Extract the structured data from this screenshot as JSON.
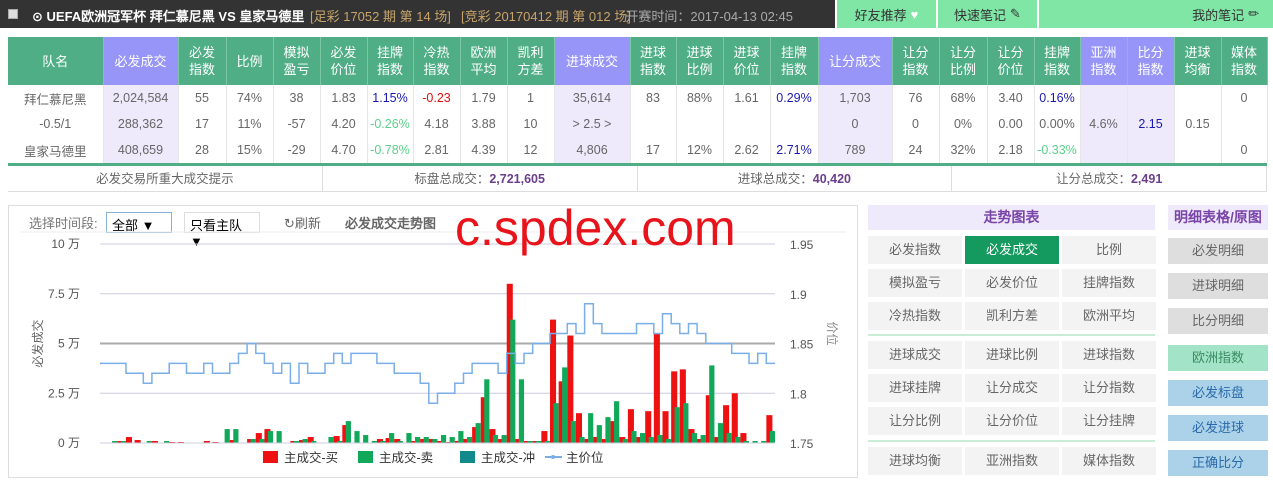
{
  "header": {
    "title": "⊙ UEFA欧洲冠军杯  拜仁慕尼黑  VS 皇家马德里",
    "zucai": "[足彩 17052 期 第 14 场]",
    "jingcai": "[竞彩 20170412 期 第 012 场]",
    "kickoff": "开赛时间：2017-04-13 02:45",
    "buttons": [
      "好友推荐",
      "快速笔记",
      "我的笔记"
    ]
  },
  "table": {
    "headers": [
      "队名",
      "必发成交",
      "必发\n指数",
      "比例",
      "模拟\n盈亏",
      "必发\n价位",
      "挂牌\n指数",
      "冷热\n指数",
      "欧洲\n平均",
      "凯利\n方差",
      "进球成交",
      "进球\n指数",
      "进球\n比例",
      "进球\n价位",
      "挂牌\n指数",
      "让分成交",
      "让分\n指数",
      "让分\n比例",
      "让分\n价位",
      "挂牌\n指数",
      "亚洲\n指数",
      "比分\n指数",
      "进球\n均衡",
      "媒体\n指数"
    ],
    "rows": [
      [
        "拜仁慕尼黑",
        "2,024,584",
        "55",
        "74%",
        "38",
        "1.83",
        "1.15%",
        "-0.23",
        "1.79",
        "1",
        "35,614",
        "83",
        "88%",
        "1.61",
        "0.29%",
        "1,703",
        "76",
        "68%",
        "3.40",
        "0.16%",
        "",
        "",
        "",
        "0"
      ],
      [
        "-0.5/1",
        "288,362",
        "17",
        "11%",
        "-57",
        "4.20",
        "-0.26%",
        "4.18",
        "3.88",
        "10",
        "> 2.5 >",
        "",
        "",
        "",
        "",
        "0",
        "0",
        "0%",
        "0.00",
        "0.00%",
        "4.6%",
        "2.15",
        "0.15",
        ""
      ],
      [
        "皇家马德里",
        "408,659",
        "28",
        "15%",
        "-29",
        "4.70",
        "-0.78%",
        "2.81",
        "4.39",
        "12",
        "4,806",
        "17",
        "12%",
        "2.62",
        "2.71%",
        "789",
        "24",
        "32%",
        "2.18",
        "-0.33%",
        "",
        "",
        "",
        "0"
      ]
    ]
  },
  "summary": {
    "tip": "必发交易所重大成交提示",
    "biaopan_label": "标盘总成交：",
    "biaopan": "2,721,605",
    "jinqiu_label": "进球总成交：",
    "jinqiu": "40,420",
    "rangfen_label": "让分总成交：",
    "rangfen": "2,491"
  },
  "controls": {
    "period_label": "选择时间段:",
    "period_value": "全部 ▼",
    "team_value": "只看主队 ▼",
    "refresh": "刷新",
    "chart_title": "必发成交走势图"
  },
  "watermark": "c.spdex.com",
  "trend_panel": {
    "title": "走势图表",
    "buttons": [
      "必发指数",
      "必发成交",
      "比例",
      "模拟盈亏",
      "必发价位",
      "挂牌指数",
      "冷热指数",
      "凯利方差",
      "欧洲平均",
      "进球成交",
      "进球比例",
      "进球指数",
      "进球挂牌",
      "让分成交",
      "让分指数",
      "让分比例",
      "让分价位",
      "让分挂牌",
      "进球均衡",
      "亚洲指数",
      "媒体指数"
    ],
    "active": "必发成交"
  },
  "detail_panel": {
    "title": "明细表格/原图",
    "buttons": [
      "必发明细",
      "进球明细",
      "比分明细",
      "欧洲指数",
      "必发标盘",
      "必发进球",
      "正确比分"
    ]
  },
  "colors": {
    "buy": "#ee1111",
    "sell": "#12a85a",
    "chong": "#12898a",
    "price": "#7aaee8",
    "header": "#4fae86",
    "accent": "#9795f7"
  },
  "chart_data": {
    "type": "bar",
    "title": "必发成交走势图",
    "ylabel": "必发成交",
    "y2label": "价位",
    "yticks": [
      "0 万",
      "2.5 万",
      "5 万",
      "7.5 万",
      "10 万"
    ],
    "ylim": [
      0,
      10
    ],
    "y2ticks": [
      "1.75",
      "1.8",
      "1.85",
      "1.9",
      "1.95"
    ],
    "y2lim": [
      1.75,
      1.95
    ],
    "legend": [
      "主成交-买",
      "主成交-卖",
      "主成交-冲",
      "主价位"
    ],
    "series": [
      {
        "name": "主成交-买",
        "values": [
          0,
          0,
          0.1,
          0.3,
          0.15,
          0,
          0.1,
          0,
          0.05,
          0.05,
          0,
          0,
          0.1,
          0.05,
          0,
          0.15,
          0,
          0.2,
          0.5,
          0.7,
          0,
          0,
          0.1,
          0.15,
          0.3,
          0,
          0,
          0.35,
          0.9,
          0,
          0,
          0,
          0.2,
          0.25,
          0.2,
          0,
          0.1,
          0.2,
          0.2,
          0.1,
          0.05,
          0.1,
          0.2,
          0.8,
          2.3,
          0.7,
          0.2,
          8.0,
          0.2,
          0.1,
          0.1,
          0.6,
          6.2,
          3.1,
          5.4,
          1.5,
          0.2,
          0.3,
          0.2,
          1.1,
          0.3,
          1.7,
          0.3,
          1.6,
          5.5,
          1.6,
          3.6,
          3.7,
          0.7,
          0.2,
          2.4,
          0.3,
          1.9,
          2.5,
          0.5,
          0,
          0,
          1.4
        ]
      },
      {
        "name": "主成交-卖",
        "values": [
          0,
          0.1,
          0.1,
          0,
          0,
          0.1,
          0,
          0.1,
          0,
          0,
          0,
          0,
          0,
          0,
          0.7,
          0.7,
          0,
          0.2,
          0.2,
          0.6,
          0.6,
          0,
          0.1,
          0.2,
          0.1,
          0,
          0.3,
          0.1,
          1.1,
          0.6,
          0.4,
          0.1,
          0.1,
          0.5,
          0.1,
          0.5,
          0.3,
          0.3,
          0.2,
          0.4,
          0.3,
          0.6,
          0.3,
          1.0,
          3.2,
          0.4,
          0.4,
          6.2,
          3.2,
          0.1,
          0.1,
          0.1,
          2.0,
          3.8,
          1.1,
          0.3,
          1.5,
          0.9,
          1.3,
          2.1,
          0.2,
          0.6,
          0.5,
          0.3,
          0.4,
          0.2,
          1.8,
          2.0,
          0.5,
          0.4,
          3.9,
          1.0,
          0.5,
          0.3,
          0.1,
          0.1,
          0.1,
          0.6
        ]
      },
      {
        "name": "主成交-冲",
        "values": []
      },
      {
        "name": "主价位",
        "values": [
          1.83,
          1.83,
          1.83,
          1.82,
          1.82,
          1.81,
          1.82,
          1.82,
          1.83,
          1.83,
          1.82,
          1.82,
          1.83,
          1.82,
          1.82,
          1.83,
          1.84,
          1.85,
          1.84,
          1.83,
          1.82,
          1.83,
          1.81,
          1.83,
          1.82,
          1.82,
          1.83,
          1.84,
          1.83,
          1.84,
          1.84,
          1.84,
          1.83,
          1.83,
          1.82,
          1.82,
          1.82,
          1.81,
          1.79,
          1.8,
          1.8,
          1.81,
          1.82,
          1.83,
          1.83,
          1.83,
          1.82,
          1.84,
          1.83,
          1.84,
          1.85,
          1.85,
          1.86,
          1.86,
          1.87,
          1.86,
          1.89,
          1.87,
          1.86,
          1.86,
          1.86,
          1.86,
          1.87,
          1.87,
          1.86,
          1.88,
          1.87,
          1.86,
          1.87,
          1.86,
          1.85,
          1.85,
          1.85,
          1.84,
          1.84,
          1.83,
          1.84,
          1.83
        ]
      }
    ]
  }
}
